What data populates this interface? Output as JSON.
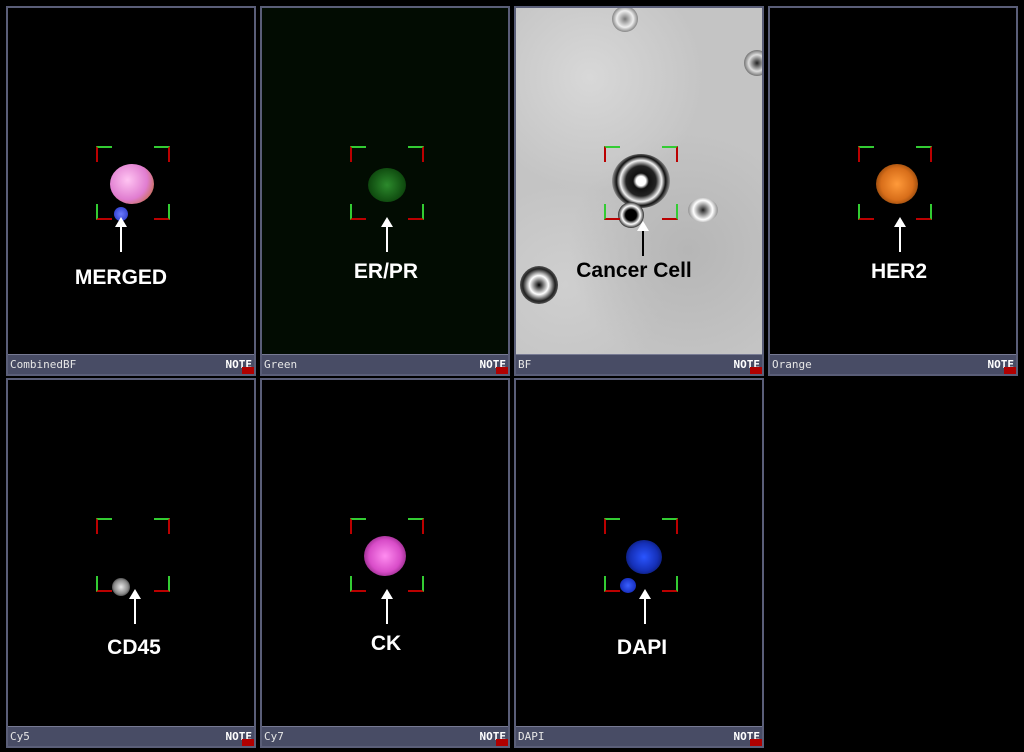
{
  "panels": [
    {
      "channel": "CombinedBF",
      "note": "NOTE",
      "marker": "MERGED"
    },
    {
      "channel": "Green",
      "note": "NOTE",
      "marker": "ER/PR"
    },
    {
      "channel": "BF",
      "note": "NOTE",
      "marker": "Cancer Cell"
    },
    {
      "channel": "Orange",
      "note": "NOTE",
      "marker": "HER2"
    },
    {
      "channel": "Cy5",
      "note": "NOTE",
      "marker": "CD45"
    },
    {
      "channel": "Cy7",
      "note": "NOTE",
      "marker": "CK"
    },
    {
      "channel": "DAPI",
      "note": "NOTE",
      "marker": "DAPI"
    }
  ],
  "colors": {
    "panel_border": "#5a5e78",
    "footer_bg": "#484c65",
    "reticle_green": "#33cc33",
    "reticle_red": "#bb0000",
    "merged_cell": "#e68ad6",
    "er_pr": "#1f7a1f",
    "her2": "#d9731a",
    "ck": "#e055d0",
    "dapi": "#1733d6"
  }
}
